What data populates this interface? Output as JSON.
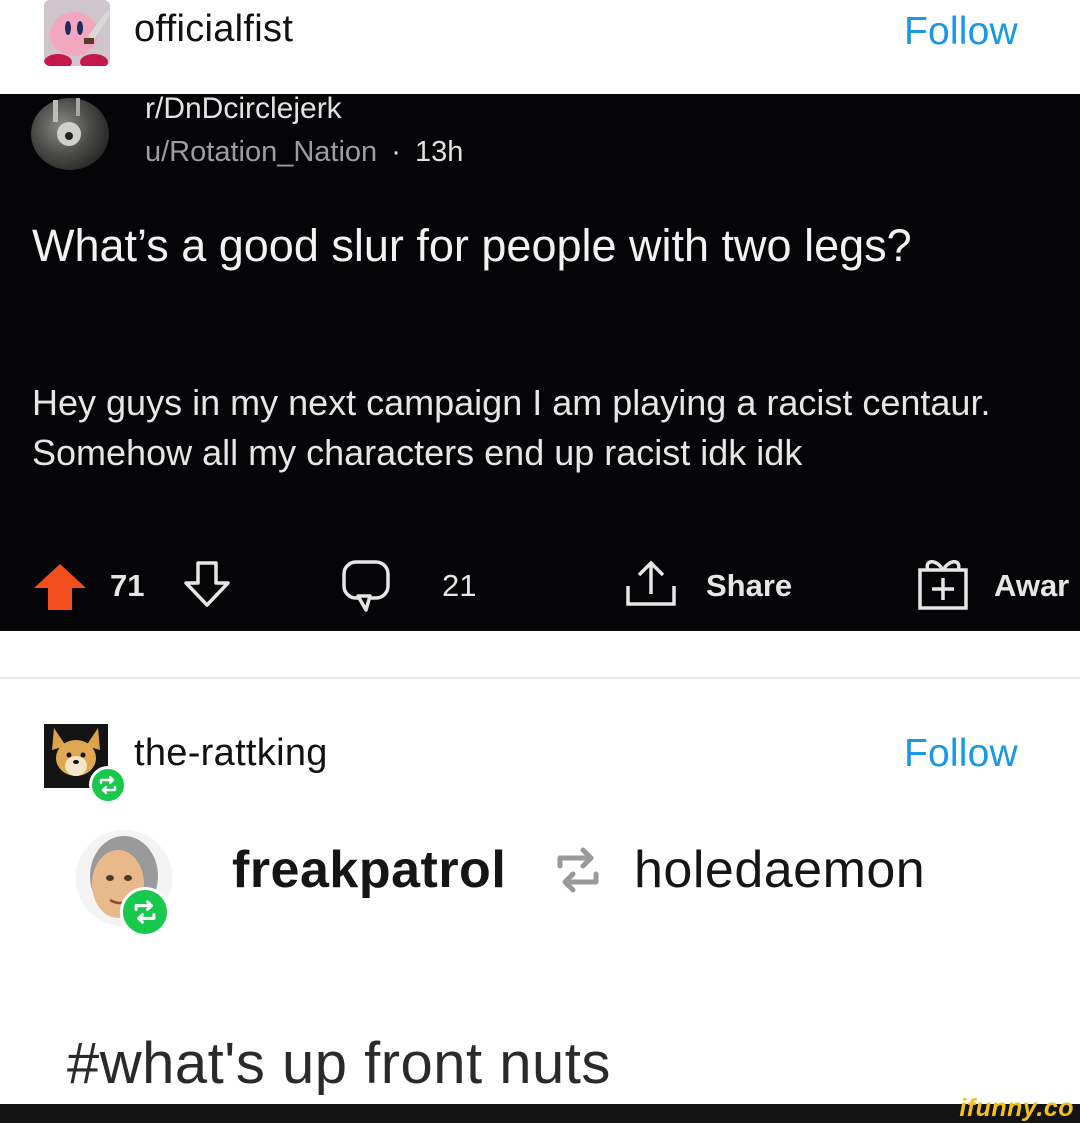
{
  "post1": {
    "username": "officialfist",
    "follow_label": "Follow",
    "avatar_icon": "kirby-knife-avatar",
    "reddit": {
      "subreddit": "r/DnDcirclejerk",
      "author": "u/Rotation_Nation",
      "separator": "·",
      "age": "13h",
      "title": "What’s a good slur for people with two legs?",
      "body": "Hey guys in my next campaign I am playing a racist centaur. Somehow all my characters end up racist idk idk",
      "upvotes": "71",
      "comments": "21",
      "share_label": "Share",
      "award_label": "Awar",
      "colors": {
        "upvote": "#f24f1c",
        "background": "#050507"
      }
    }
  },
  "post2": {
    "username": "the-rattking",
    "follow_label": "Follow",
    "reblog": {
      "from_user": "freakpatrol",
      "original_user": "holedaemon"
    },
    "hashtag": "#what's up front nuts"
  },
  "watermark": "ifunny.co",
  "colors": {
    "follow": "#1a98e6",
    "reblog_badge": "#18c94e"
  }
}
